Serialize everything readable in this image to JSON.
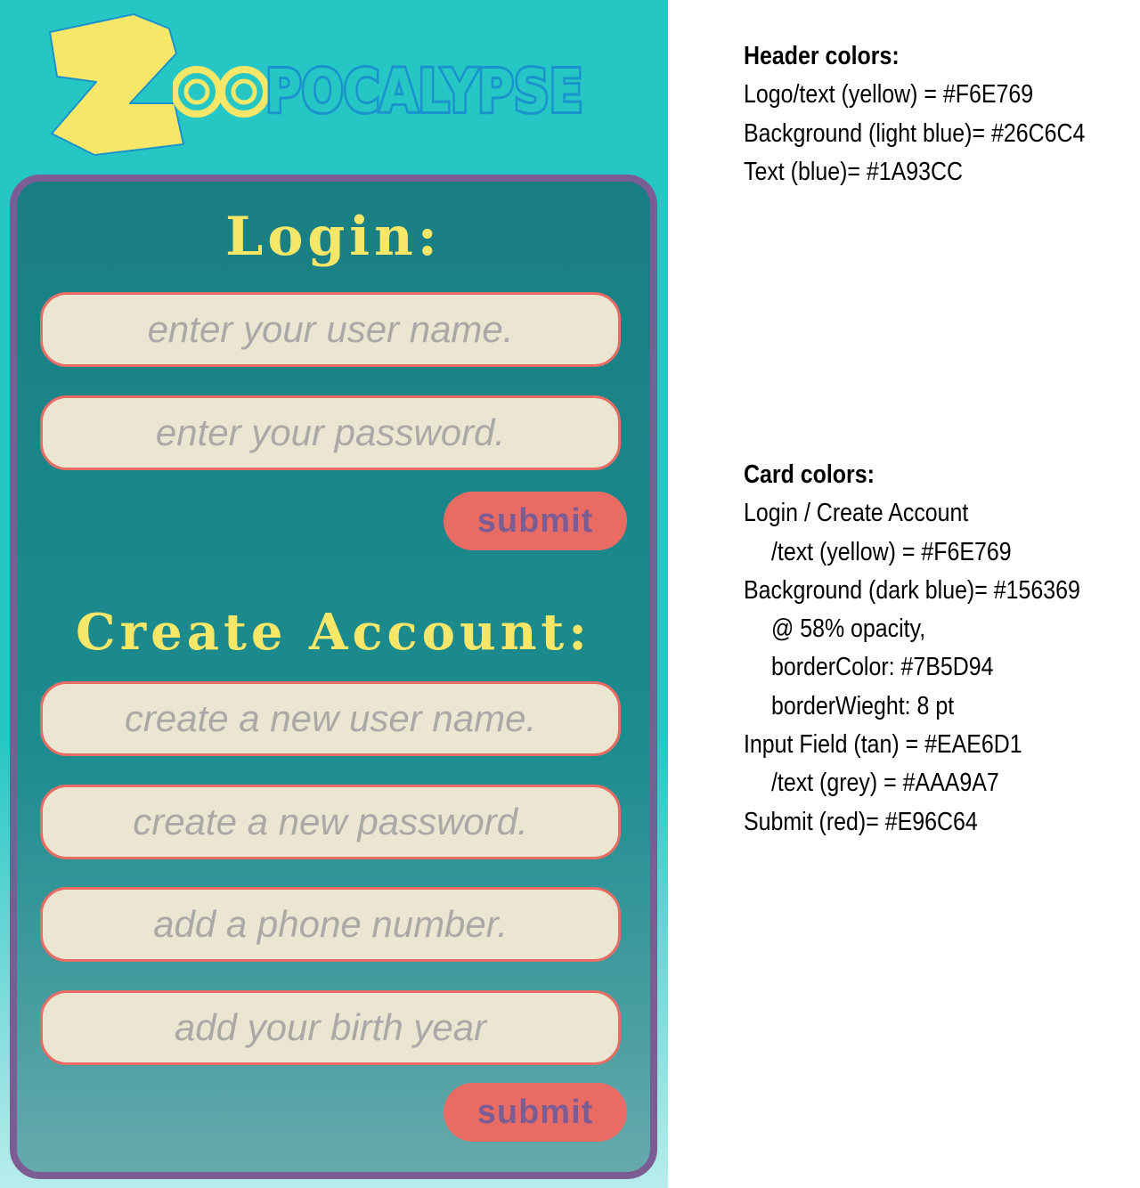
{
  "logo": {
    "letter_z": "Z",
    "letters_oo": "OO",
    "rest": "POCALYPSE"
  },
  "login": {
    "heading": "Login:",
    "username_placeholder": "enter your user name.",
    "password_placeholder": "enter your password.",
    "submit_label": "submit"
  },
  "create_account": {
    "heading": "Create Account:",
    "username_placeholder": "create a new user name.",
    "password_placeholder": "create a new password.",
    "phone_placeholder": "add a phone number.",
    "birth_year_placeholder": "add your birth year",
    "submit_label": "submit"
  },
  "notes": {
    "header": {
      "title": "Header colors:",
      "lines": [
        "Logo/text (yellow) = #F6E769",
        "Background (light blue)= #26C6C4",
        "Text (blue)= #1A93CC"
      ]
    },
    "card": {
      "title": "Card colors:",
      "lines": [
        "Login / Create Account",
        "/text (yellow) = #F6E769",
        "Background (dark blue)= #156369",
        "@ 58% opacity,",
        "borderColor: #7B5D94",
        "borderWieght: 8 pt",
        "Input Field (tan) = #EAE6D1",
        "/text (grey) = #AAA9A7",
        "Submit (red)= #E96C64"
      ]
    }
  },
  "colors": {
    "yellow": "#F6E769",
    "light_blue": "#26C6C4",
    "blue": "#1A93CC",
    "dark_blue": "#156369",
    "border": "#7B5D94",
    "input_tan": "#EAE6D1",
    "input_text_grey": "#AAA9A7",
    "submit_red": "#E96C64"
  }
}
